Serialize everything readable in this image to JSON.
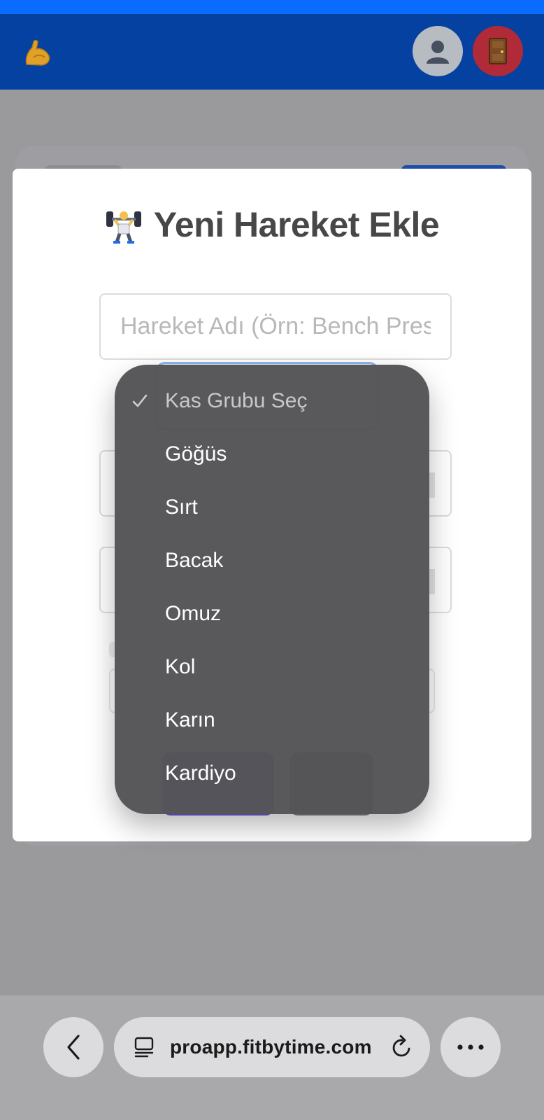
{
  "modal": {
    "title": "Yeni Hareket Ekle",
    "name_placeholder": "Hareket Adı (Örn: Bench Press)"
  },
  "picker": {
    "options": [
      {
        "label": "Kas Grubu Seç",
        "selected": true
      },
      {
        "label": "Göğüs",
        "selected": false
      },
      {
        "label": "Sırt",
        "selected": false
      },
      {
        "label": "Bacak",
        "selected": false
      },
      {
        "label": "Omuz",
        "selected": false
      },
      {
        "label": "Kol",
        "selected": false
      },
      {
        "label": "Karın",
        "selected": false
      },
      {
        "label": "Kardiyo",
        "selected": false
      }
    ]
  },
  "browser": {
    "url": "proapp.fitbytime.com"
  },
  "icons": {
    "logo": "flexed-biceps-icon",
    "avatar": "user-icon",
    "logout": "door-icon",
    "title": "weight-lifter-icon",
    "back": "chevron-left-icon",
    "tabs": "tabs-icon",
    "reload": "reload-icon",
    "more": "more-icon"
  },
  "colors": {
    "header": "#0541a0",
    "top_strip": "#0a6cff",
    "logout": "#b02a37",
    "title_text": "#474747",
    "picker_bg": "#545456"
  }
}
